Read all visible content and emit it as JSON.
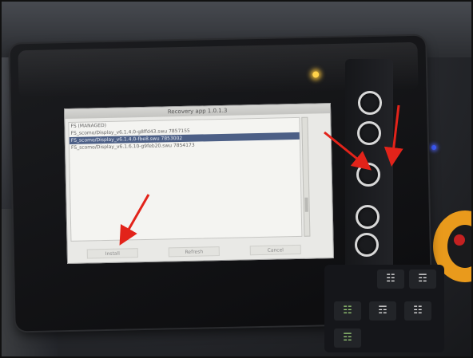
{
  "dialog": {
    "title": "Recovery app 1.0.1.3",
    "files": [
      "FS (MANAGED)",
      "FS_scomo/Display_v6.1.4.0-g8ffd43.swu   7857155",
      "FS_scomo/Display_v6.1.4.0-fbe8.swu   7853002",
      "FS_scomo/Display_v6.1.6.10-g9feb20.swu   7854173"
    ],
    "selected_index": 2,
    "buttons": {
      "left": "Install",
      "middle": "Refresh",
      "right": "Cancel"
    }
  },
  "hardware": {
    "side_buttons": [
      "button-1",
      "button-2",
      "button-3",
      "button-4",
      "button-5"
    ],
    "keypad_icons": [
      "vehicle-front-icon",
      "vehicle-side-icon",
      "vehicle-tilt-icon",
      "vehicle-front-icon",
      "vehicle-side-icon",
      "vehicle-tilt-icon"
    ]
  },
  "colors": {
    "arrow": "#e2231a",
    "screen_bg": "#e9e9e6",
    "selection": "#4c5f86",
    "led": "#ffd24a"
  }
}
